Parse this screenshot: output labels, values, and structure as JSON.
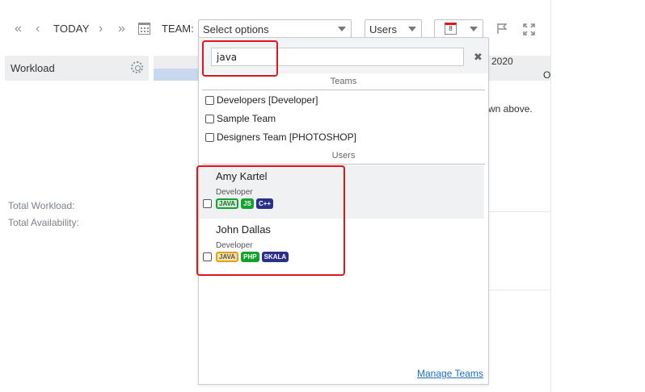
{
  "toolbar": {
    "today_label": "TODAY",
    "team_label": "TEAM:",
    "team_select_value": "Select options",
    "view_select_value": "Users",
    "calendar_badge": "8"
  },
  "left_panel": {
    "workload_title": "Workload",
    "total_workload_label": "Total Workload:",
    "total_availability_label": "Total Availability:"
  },
  "timeline": {
    "year": "2020",
    "fragment_letter": "O",
    "background_text": "wn above."
  },
  "dropdown": {
    "search_value": "java",
    "clear_symbol": "✖",
    "teams_header": "Teams",
    "teams": [
      {
        "label": "Developers [Developer]",
        "checked": false
      },
      {
        "label": "Sample Team",
        "checked": false
      },
      {
        "label": "Designers Team [PHOTOSHOP]",
        "checked": false
      }
    ],
    "users_header": "Users",
    "users": [
      {
        "name": "Amy Kartel",
        "role": "Developer",
        "tags": [
          "JAVA",
          "JS",
          "C++"
        ],
        "checked": false
      },
      {
        "name": "John Dallas",
        "role": "Developer",
        "tags": [
          "JAVA",
          "PHP",
          "SKALA"
        ],
        "checked": false
      }
    ],
    "manage_link": "Manage Teams"
  },
  "colors": {
    "highlight_red": "#e3141b",
    "tag_green": "#12a32e",
    "tag_navy": "#2a2f8a",
    "link_blue": "#1b6fc2"
  }
}
